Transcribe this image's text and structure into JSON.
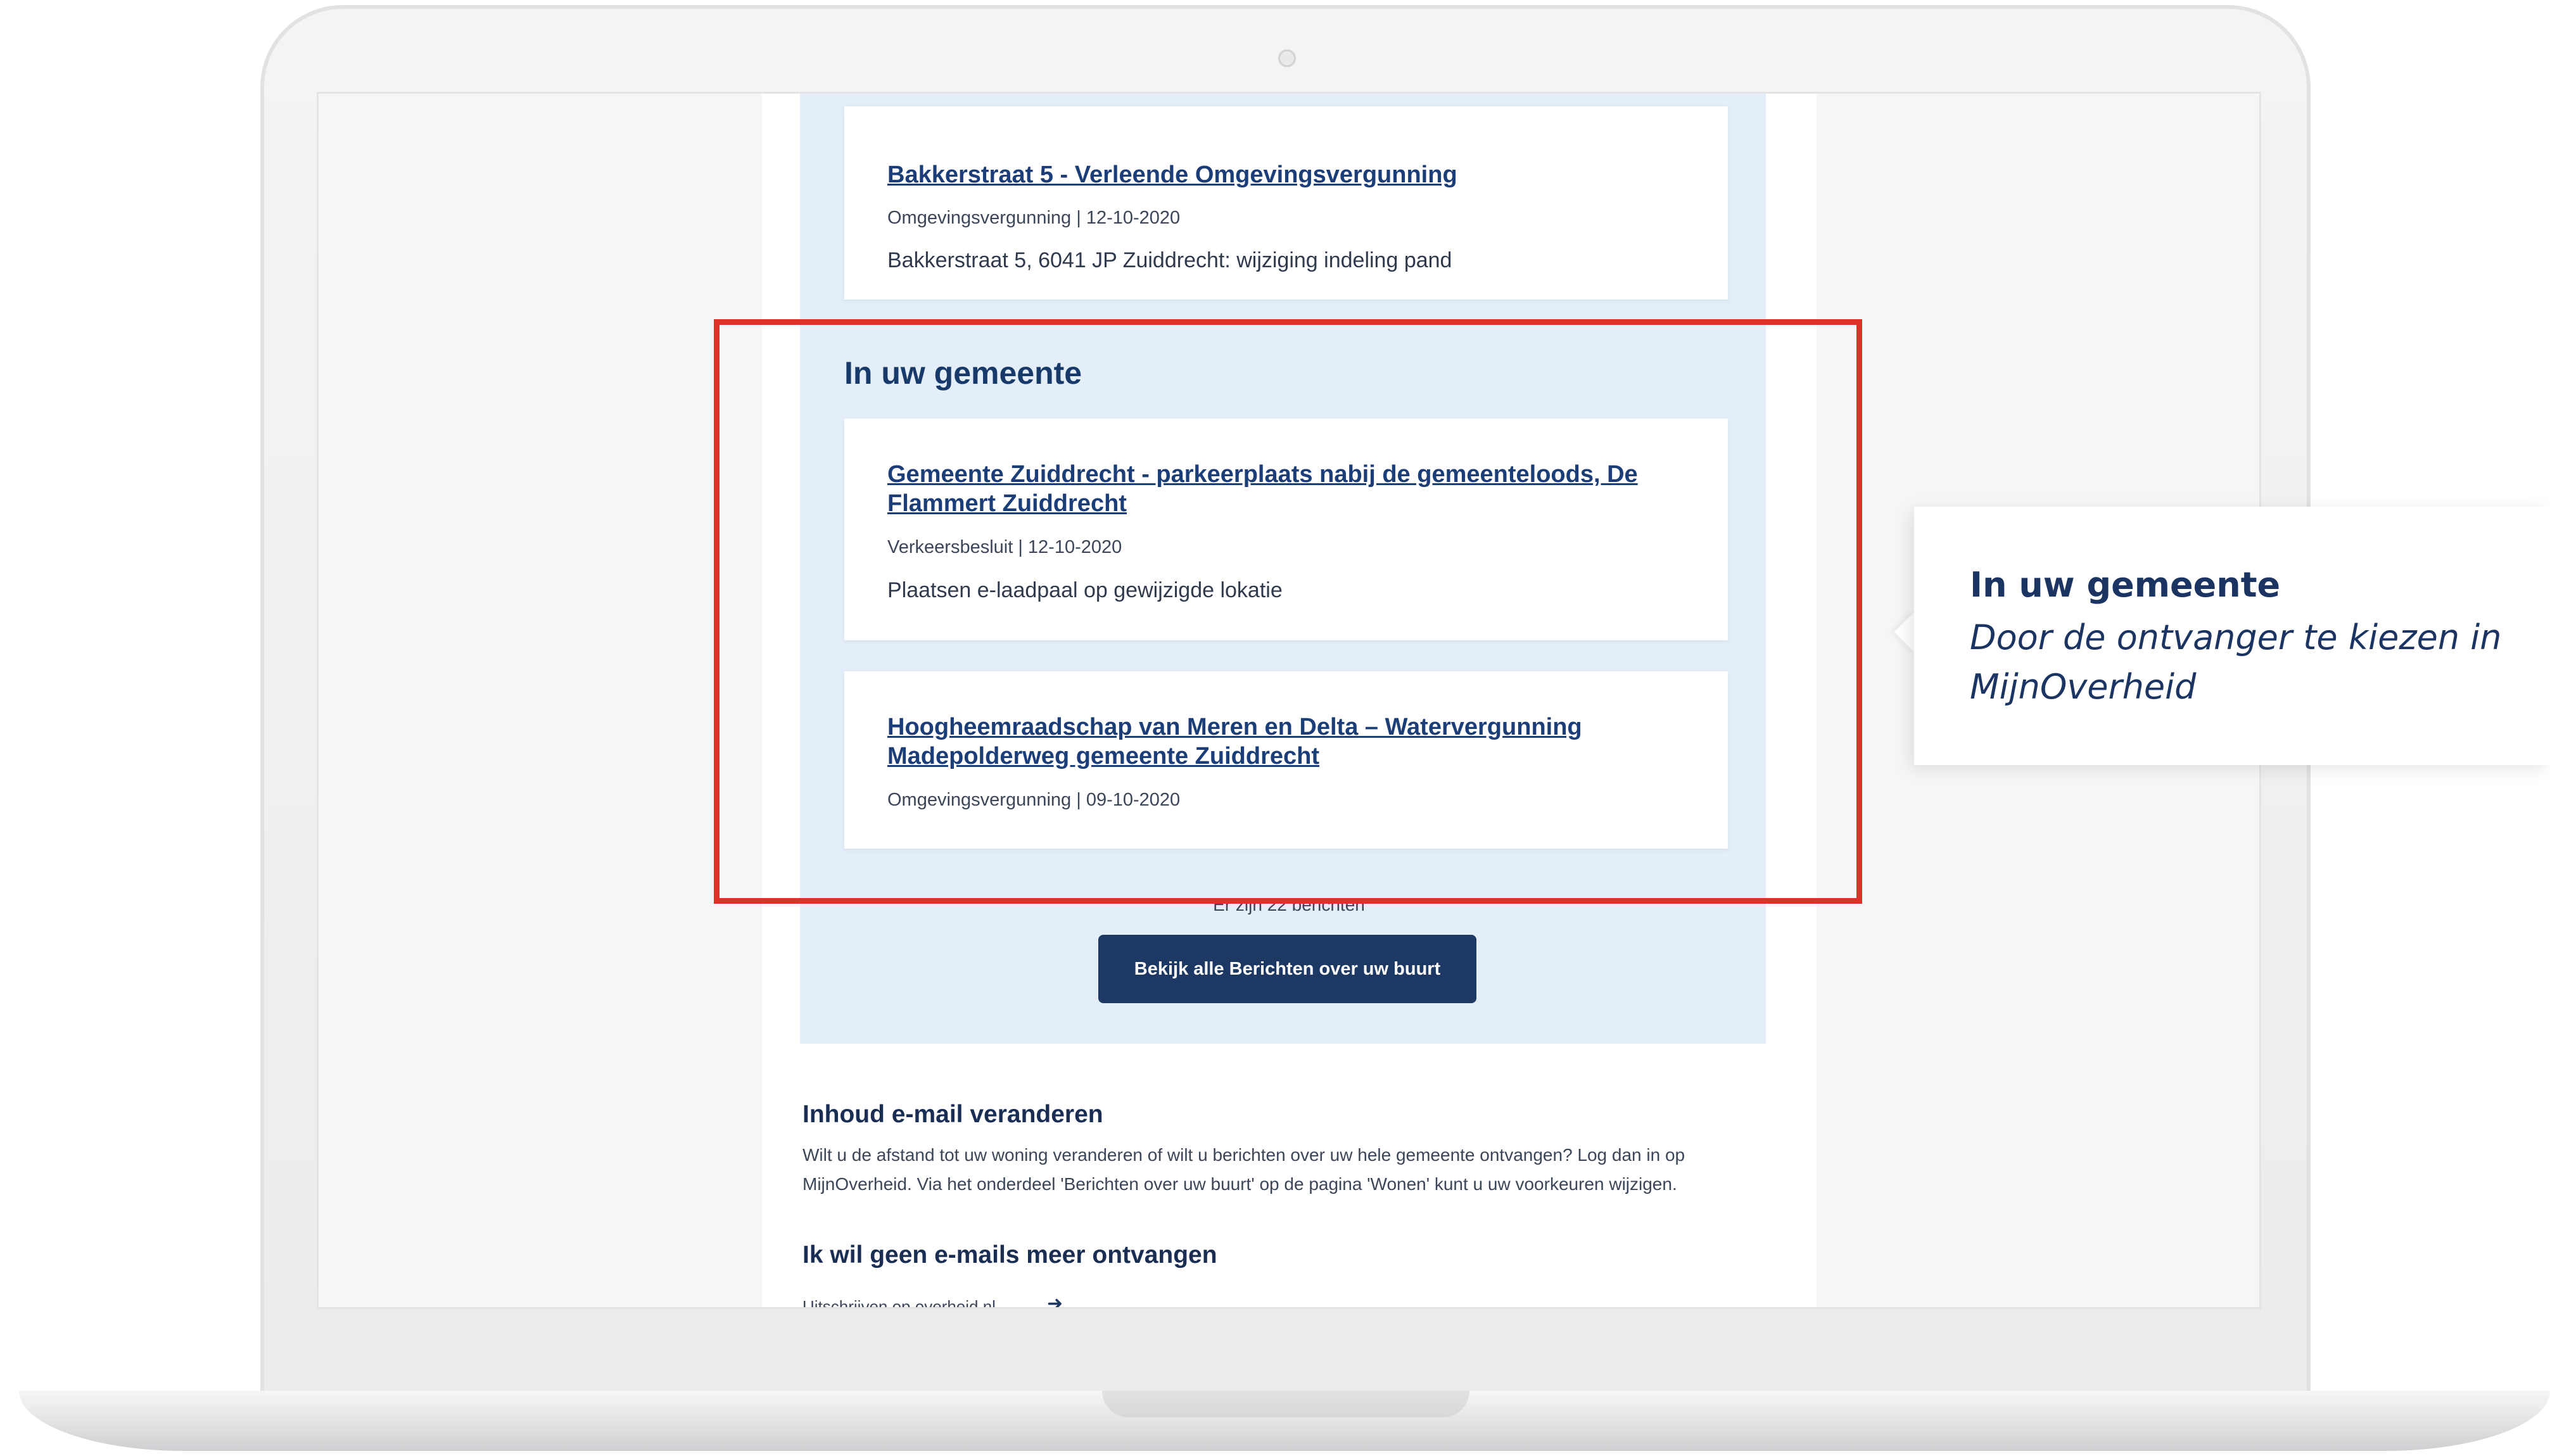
{
  "card_top": {
    "title": "Bakkerstraat 5 - Verleende Omgevingsvergunning",
    "meta": "Omgevingsvergunning  |  12-10-2020",
    "description": "Bakkerstraat 5, 6041 JP Zuiddrecht: wijziging indeling pand"
  },
  "section": {
    "heading": "In uw gemeente",
    "items": [
      {
        "title": "Gemeente Zuiddrecht - parkeerplaats nabij de gemeenteloods, De Flammert Zuiddrecht",
        "meta": "Verkeersbesluit  |  12-10-2020",
        "description": "Plaatsen e-laadpaal op gewijzigde lokatie"
      },
      {
        "title": "Hoogheemraadschap van Meren en Delta – Watervergunning Madepolderweg gemeente Zuiddrecht",
        "meta": "Omgevingsvergunning  |  09-10-2020"
      }
    ]
  },
  "count_text": "Er zijn 22 berichten",
  "cta_label": "Bekijk alle Berichten over uw buurt",
  "change_section": {
    "heading": "Inhoud e-mail veranderen",
    "text": "Wilt u de afstand tot uw woning veranderen of wilt u berichten over uw hele gemeente ontvangen? Log dan in op MijnOverheid. Via het onderdeel 'Berichten over uw buurt' op de pagina 'Wonen' kunt u uw voorkeuren wijzigen."
  },
  "unsubscribe_section": {
    "heading": "Ik wil geen e-mails meer ontvangen",
    "link": "Uitschrijven op overheid.nl"
  },
  "callout": {
    "title": "In uw gemeente",
    "text": "Door de ontvanger te kiezen in MijnOverheid"
  },
  "colors": {
    "highlight": "#e0302a",
    "brand_blue": "#1c3863",
    "panel_blue": "#e3eef8"
  },
  "icons": {
    "unsubscribe_arrow": "arrow-right-icon"
  }
}
